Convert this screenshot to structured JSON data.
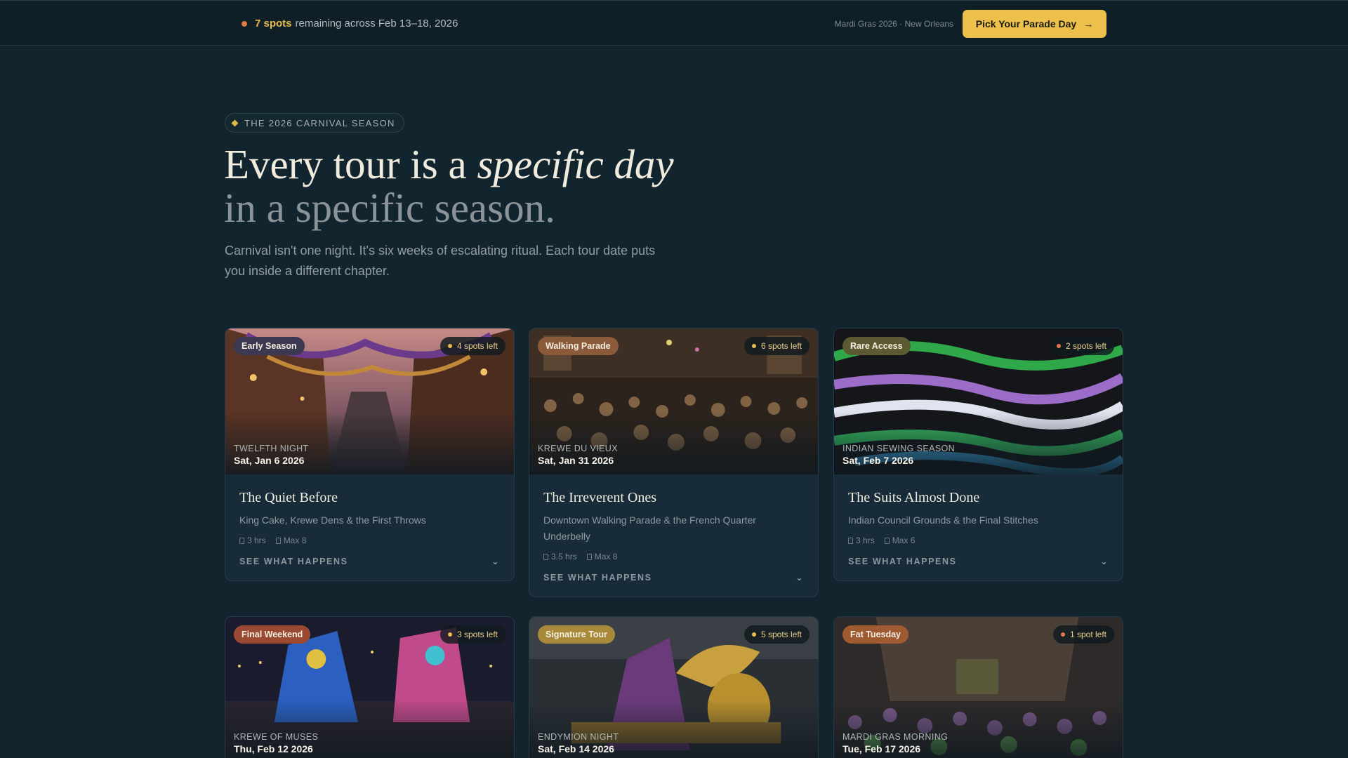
{
  "topbar": {
    "spots_count": "7 spots",
    "spots_text": "remaining across Feb 13–18, 2026",
    "brand_line": "Mardi Gras 2026 · New Orleans",
    "cta_label": "Pick Your Parade Day",
    "cta_icon": "arrow-right-icon"
  },
  "hero": {
    "eyebrow": "THE 2026 CARNIVAL SEASON",
    "headline_a": "Every tour is a ",
    "headline_em": "specific day",
    "headline_b": "in a specific season.",
    "lede": "Carnival isn't one night. It's six weeks of escalating ritual. Each tour date puts you inside a different chapter."
  },
  "cards": [
    {
      "tag": "Early Season",
      "tag_color": "#3d3852",
      "availability": "4 spots left",
      "event": "TWELFTH NIGHT",
      "date": "Sat, Jan 6 2026",
      "title": "The Quiet Before",
      "subtitle": "King Cake, Krewe Dens & the First Throws",
      "duration": "3 hrs",
      "group": "Max 8",
      "more": "SEE WHAT HAPPENS"
    },
    {
      "tag": "Walking Parade",
      "tag_color": "#8a5a3a",
      "availability": "6 spots left",
      "event": "KREWE DU VIEUX",
      "date": "Sat, Jan 31 2026",
      "title": "The Irreverent Ones",
      "subtitle": "Downtown Walking Parade & the French Quarter Underbelly",
      "duration": "3.5 hrs",
      "group": "Max 8",
      "more": "SEE WHAT HAPPENS"
    },
    {
      "tag": "Rare Access",
      "tag_color": "#5b5a32",
      "availability": "2 spots left",
      "event": "INDIAN SEWING SEASON",
      "date": "Sat, Feb 7 2026",
      "title": "The Suits Almost Done",
      "subtitle": "Indian Council Grounds & the Final Stitches",
      "duration": "3 hrs",
      "group": "Max 6",
      "more": "SEE WHAT HAPPENS"
    },
    {
      "tag": "Final Weekend",
      "tag_color": "#9a4a32",
      "availability": "3 spots left",
      "event": "KREWE OF MUSES",
      "date": "Thu, Feb 12 2026"
    },
    {
      "tag": "Signature Tour",
      "tag_color": "#a88a3a",
      "availability": "5 spots left",
      "event": "ENDYMION NIGHT",
      "date": "Sat, Feb 14 2026"
    },
    {
      "tag": "Fat Tuesday",
      "tag_color": "#a05a32",
      "availability": "1 spot left",
      "event": "MARDI GRAS MORNING",
      "date": "Tue, Feb 17 2026"
    }
  ]
}
